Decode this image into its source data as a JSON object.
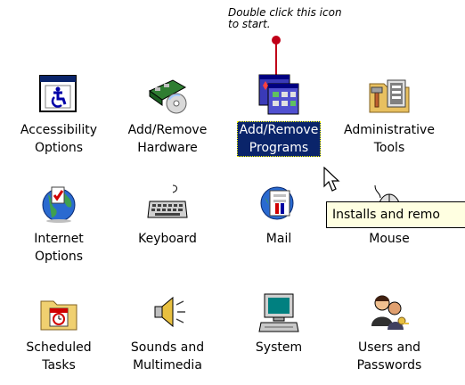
{
  "callout": {
    "text": "Double click this icon to start."
  },
  "items": [
    {
      "label": "Accessibility\nOptions",
      "icon": "accessibility-icon"
    },
    {
      "label": "Add/Remove\nHardware",
      "icon": "add-remove-hardware-icon"
    },
    {
      "label": "Add/Remove\nPrograms",
      "icon": "add-remove-programs-icon",
      "selected": true
    },
    {
      "label": "Administrative\nTools",
      "icon": "administrative-tools-icon"
    },
    {
      "label": "Internet\nOptions",
      "icon": "internet-options-icon"
    },
    {
      "label": "Keyboard",
      "icon": "keyboard-icon"
    },
    {
      "label": "Mail",
      "icon": "mail-icon"
    },
    {
      "label": "Mouse",
      "icon": "mouse-icon"
    },
    {
      "label": "Scheduled\nTasks",
      "icon": "scheduled-tasks-icon"
    },
    {
      "label": "Sounds and\nMultimedia",
      "icon": "sounds-multimedia-icon"
    },
    {
      "label": "System",
      "icon": "system-icon"
    },
    {
      "label": "Users and\nPasswords",
      "icon": "users-passwords-icon"
    }
  ],
  "tooltip": {
    "text": "Installs and remo"
  },
  "colors": {
    "selection_bg": "#0a246a",
    "callout_line": "#c00018",
    "tooltip_bg": "#ffffe1"
  }
}
